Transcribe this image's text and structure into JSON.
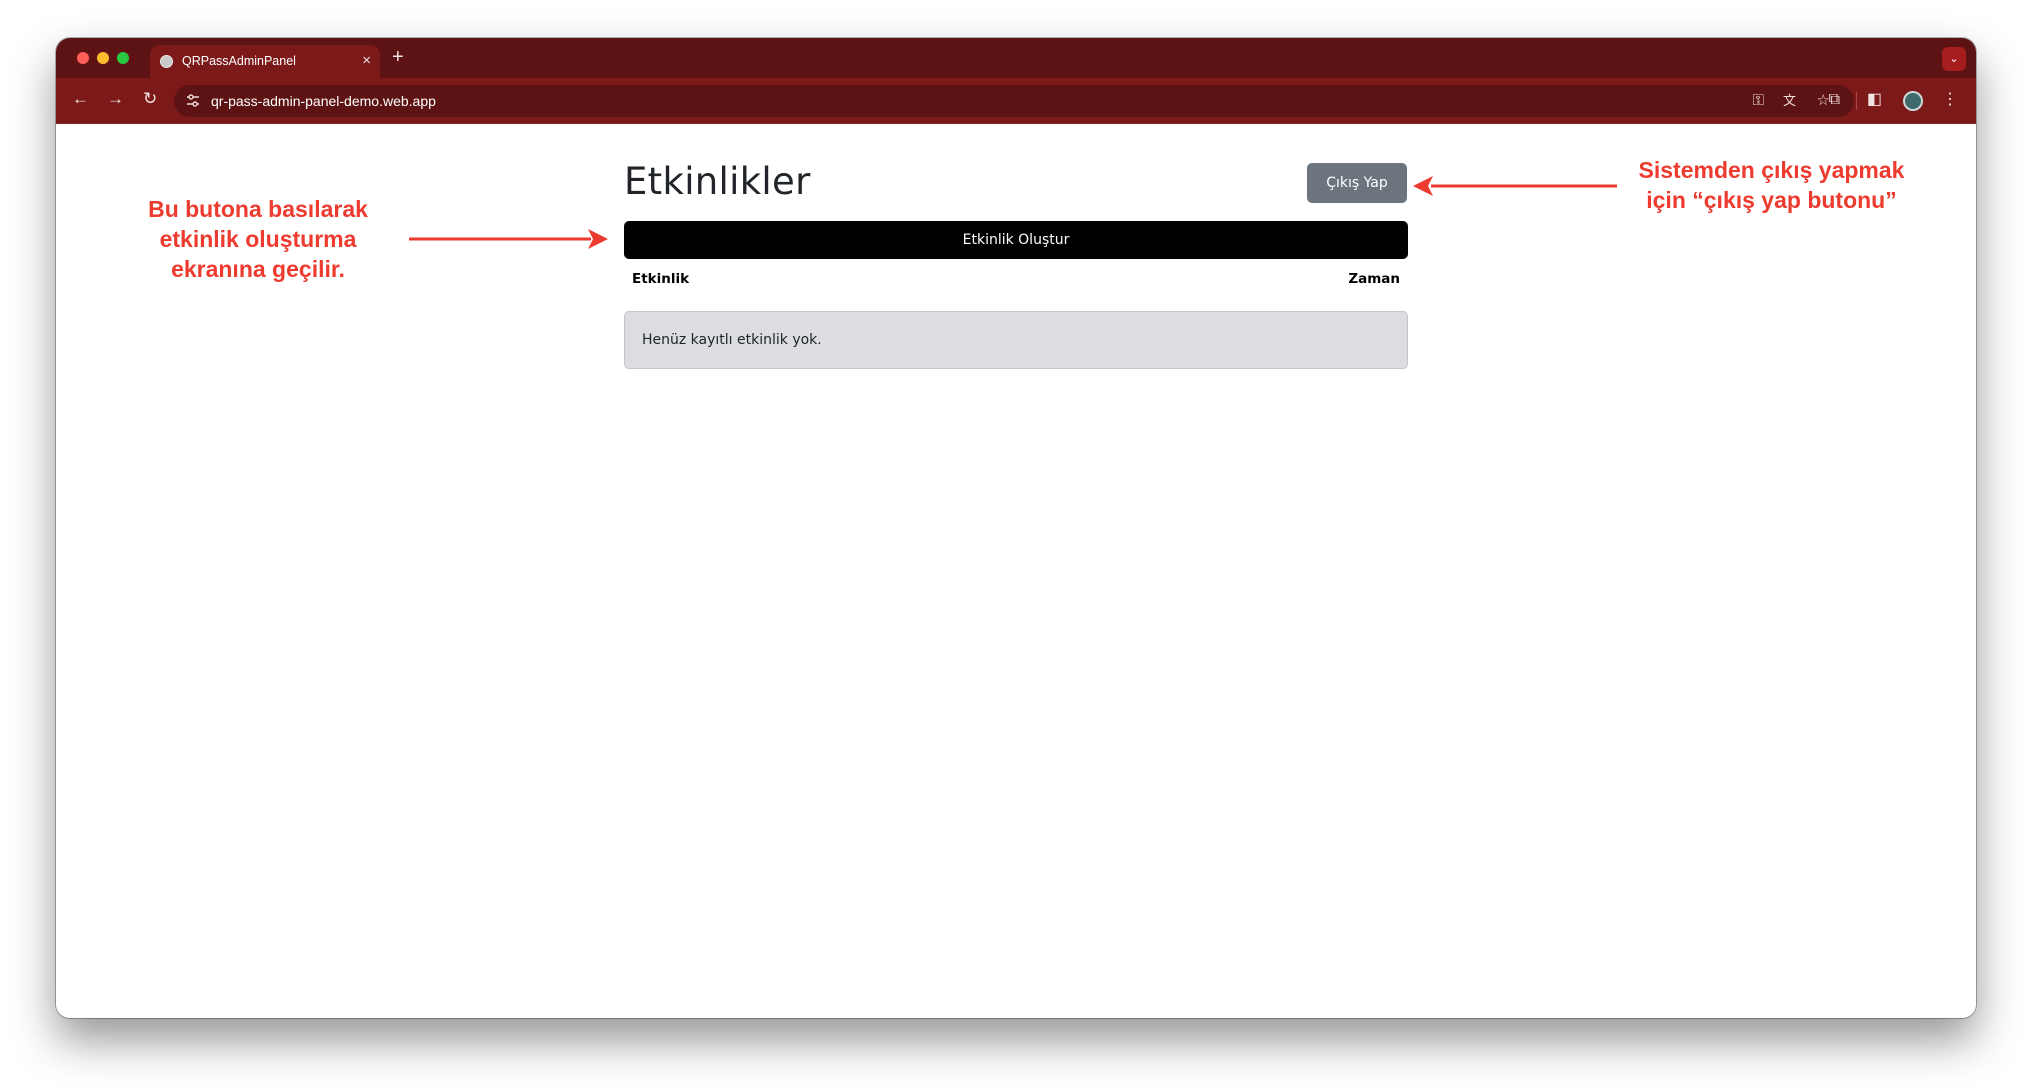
{
  "browser": {
    "tab_title": "QRPassAdminPanel",
    "tab_close": "×",
    "new_tab": "+",
    "tab_menu": "⌄",
    "url": "qr-pass-admin-panel-demo.web.app",
    "icons": {
      "back": "←",
      "forward": "→",
      "reload": "↻",
      "key": "⚿",
      "translate": "文",
      "star": "☆",
      "extensions": "⧉",
      "side_panel": "◧",
      "menu": "⋮"
    }
  },
  "page": {
    "title": "Etkinlikler",
    "logout_label": "Çıkış Yap",
    "create_label": "Etkinlik Oluştur",
    "columns": [
      "Etkinlik",
      "Zaman"
    ],
    "empty_message": "Henüz kayıtlı etkinlik yok."
  },
  "annotations": {
    "left_lines": [
      "Bu butona basılarak",
      "etkinlik oluşturma",
      "ekranına geçilir."
    ],
    "right_lines": [
      "Sistemden çıkış yapmak",
      "için “çıkış yap butonu”"
    ],
    "color": "#ee3b2f"
  },
  "colors": {
    "tabbar": "#5d1313",
    "toolbar": "#7c1a1a",
    "logout_button": "#6c757d",
    "create_button": "#000000",
    "empty_box": "#dcdde0"
  }
}
